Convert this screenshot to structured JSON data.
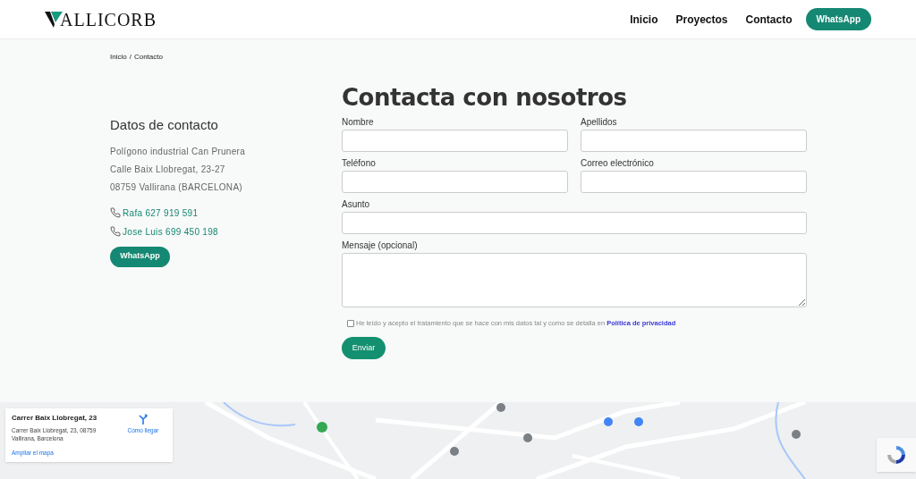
{
  "header": {
    "logo": "ALLICORB",
    "nav": [
      {
        "label": "Inicio"
      },
      {
        "label": "Proyectos"
      },
      {
        "label": "Contacto"
      }
    ],
    "cta": "WhatsApp"
  },
  "breadcrumb": [
    "Inicio",
    "/",
    "Contacto"
  ],
  "contact": {
    "title": "Datos de contacto",
    "address": [
      "Polígono industrial Can Prunera",
      "Calle Baix Llobregat, 23-27",
      "08759 Vallirana (BARCELONA)"
    ],
    "phones": [
      "Rafa 627 919 591",
      "Jose Luis 699 450 198"
    ],
    "button": "WhatsApp"
  },
  "form": {
    "title": "Contacta con nosotros",
    "fields": [
      {
        "label": "Nombre",
        "kind": "input"
      },
      {
        "label": "Apellidos",
        "kind": "input"
      },
      {
        "label": "Teléfono",
        "kind": "input"
      },
      {
        "label": "Correo electrónico",
        "kind": "input"
      },
      {
        "label": "Asunto",
        "kind": "input",
        "wide": true
      },
      {
        "label": "Mensaje (opcional)",
        "kind": "textarea",
        "wide": true
      }
    ],
    "consent": {
      "text": "He leído y acepto el tratamiento que se hace con mis datos tal y como se detalla en",
      "link": "Política de privacidad",
      "checked": false
    },
    "submit": "Enviar"
  },
  "map": {
    "kind": "picture",
    "card": {
      "title": "Carrer Baix Llobregat, 23",
      "address": "Carrer Baix Llobregat, 23, 08759 Vallirana, Barcelona",
      "directions": "Cómo llegar",
      "enlarge": "Ampliar el mapa"
    }
  }
}
